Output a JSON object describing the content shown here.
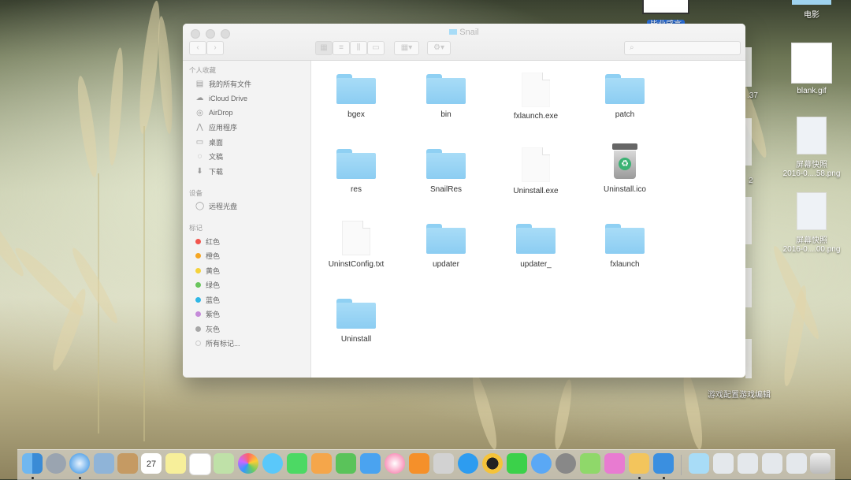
{
  "desktop": {
    "icons": [
      {
        "label": "毕业感言",
        "selected": true
      },
      {
        "label": "电影"
      },
      {
        "label": "blank.gif"
      },
      {
        "label_line1": "屏幕快照",
        "label_line2": "2016-0....58.png"
      },
      {
        "label_line1": "屏幕快照",
        "label_line2": "2016-0....00.png"
      }
    ],
    "partial_texts": [
      ".37",
      "2",
      "游戏配置游戏编辑"
    ]
  },
  "finder": {
    "title": "Snail",
    "sidebar": {
      "sections": [
        {
          "header": "个人收藏",
          "items": [
            "我的所有文件",
            "iCloud Drive",
            "AirDrop",
            "应用程序",
            "桌面",
            "文稿",
            "下载"
          ]
        },
        {
          "header": "设备",
          "items": [
            "远程光盘"
          ]
        },
        {
          "header": "标记",
          "items": [
            "红色",
            "橙色",
            "黄色",
            "绿色",
            "蓝色",
            "紫色",
            "灰色",
            "所有标记..."
          ]
        }
      ]
    },
    "tag_colors": [
      "#f2554d",
      "#f5a623",
      "#f5d23a",
      "#6ac55c",
      "#2fb7e6",
      "#c58bd9",
      "#a7a7a7"
    ],
    "files": [
      {
        "name": "bgex",
        "kind": "folder"
      },
      {
        "name": "bin",
        "kind": "folder"
      },
      {
        "name": "fxlaunch.exe",
        "kind": "doc"
      },
      {
        "name": "patch",
        "kind": "folder"
      },
      {
        "name": "res",
        "kind": "folder"
      },
      {
        "name": "SnailRes",
        "kind": "folder"
      },
      {
        "name": "Uninstall.exe",
        "kind": "doc"
      },
      {
        "name": "Uninstall.ico",
        "kind": "trash-icon"
      },
      {
        "name": "UninstConfig.txt",
        "kind": "doc"
      },
      {
        "name": "updater",
        "kind": "folder"
      },
      {
        "name": "updater_",
        "kind": "folder"
      },
      {
        "name": "fxlaunch",
        "kind": "folder"
      },
      {
        "name": "Uninstall",
        "kind": "folder"
      }
    ]
  },
  "dock": {
    "calendar_day": "27",
    "app_icons": [
      "finder-icon",
      "launchpad-icon",
      "safari-icon",
      "mail-icon",
      "contacts-icon",
      "calendar-icon",
      "notes-icon",
      "reminders-icon",
      "maps-icon",
      "photos-icon",
      "messages-icon",
      "facetime-icon",
      "pages-icon",
      "numbers-icon",
      "keynote-icon",
      "itunes-icon",
      "ibooks-icon",
      "app-store-icon",
      "system-prefs-icon",
      "qq-icon",
      "iqiyi-icon",
      "baidu-icon",
      "settings-icon",
      "wechat-icon",
      "mail-plane-icon",
      "tools-icon",
      "app-grid-icon"
    ],
    "right_icons": [
      "folder-icon",
      "downloads-icon",
      "documents-icon",
      "desktop-folder-icon",
      "stack-icon",
      "trash-icon"
    ]
  }
}
